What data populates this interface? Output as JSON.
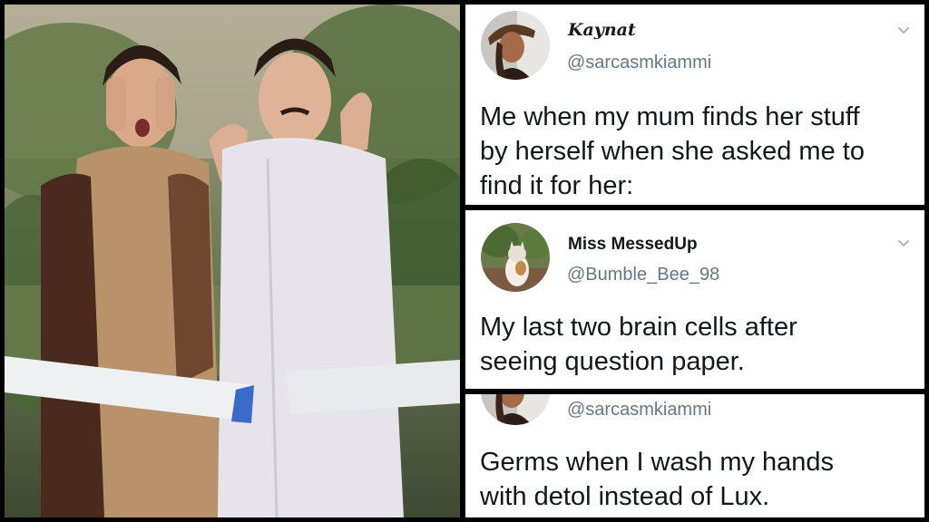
{
  "tweets": [
    {
      "display_name": "Kaynat",
      "handle": "@sarcasmkiammi",
      "text": "Me when my mum finds her stuff\nby herself when she asked me to\nfind it for her:",
      "menu_icon": "chevron-down-icon"
    },
    {
      "display_name": "Miss MessedUp",
      "handle": "@Bumble_Bee_98",
      "text": "My last two brain cells after\nseeing question paper.",
      "menu_icon": "chevron-down-icon"
    },
    {
      "handle": "@sarcasmkiammi",
      "text": "Germs when I wash my hands\nwith detol instead of Lux."
    }
  ],
  "colors": {
    "name": "#14171a",
    "handle": "#657786",
    "chevron": "#aab8c2",
    "separator": "#000000"
  }
}
